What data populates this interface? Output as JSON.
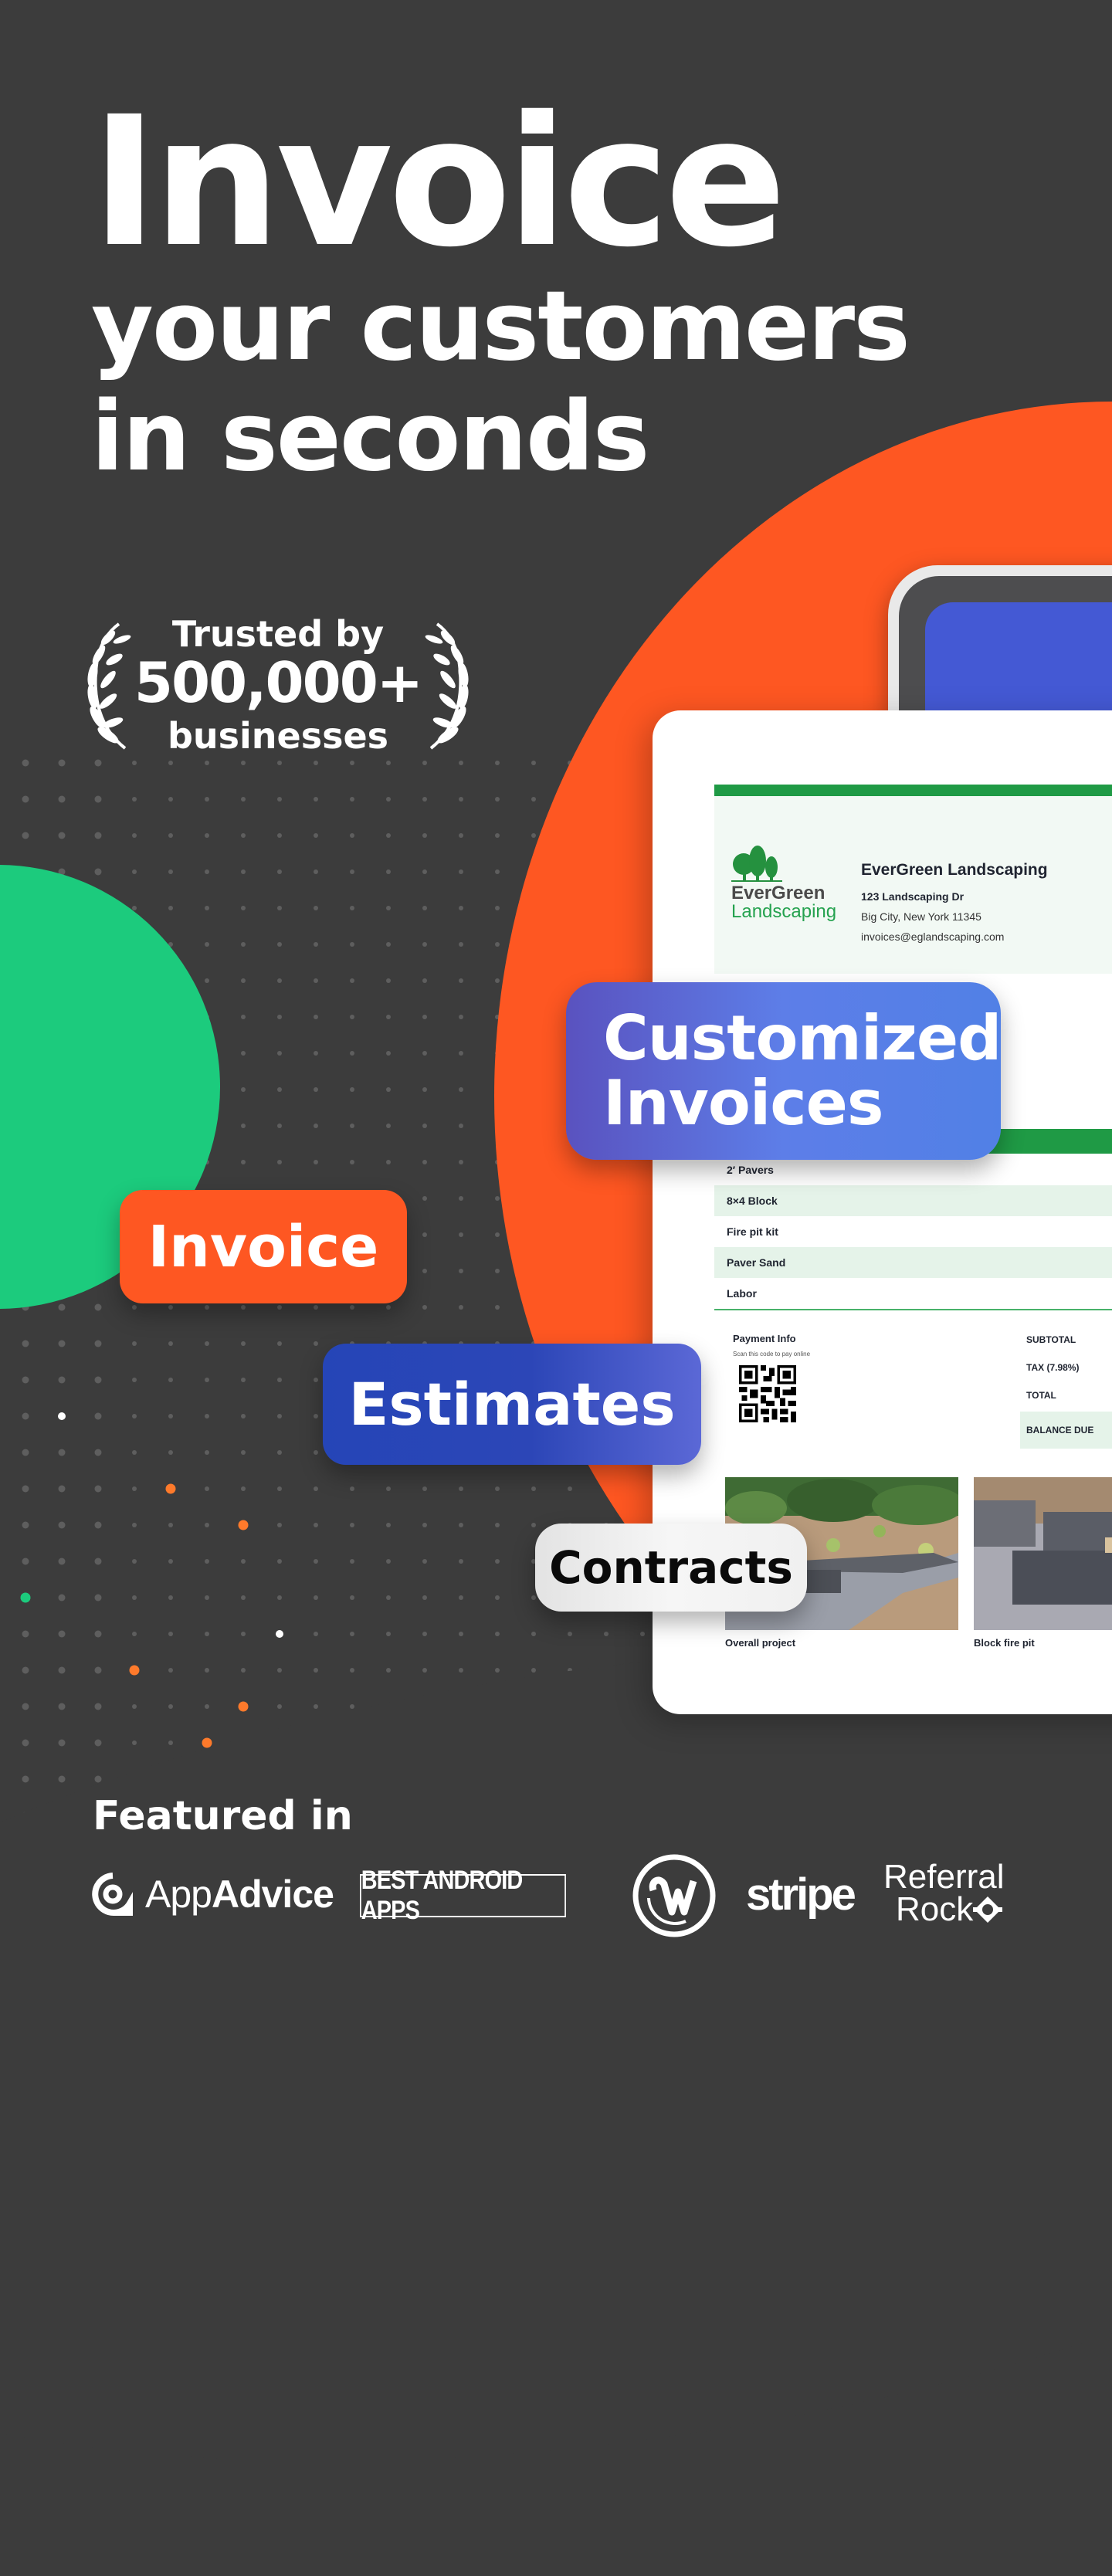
{
  "headline": {
    "line1": "Invoice",
    "line2": "your customers",
    "line3": "in seconds"
  },
  "trust_badge": {
    "line1": "Trusted by",
    "count": "500,000+",
    "line3": "businesses"
  },
  "feature_pills": {
    "customized_line1": "Customized",
    "customized_line2": "Invoices",
    "invoice": "Invoice",
    "estimates": "Estimates",
    "contracts": "Contracts"
  },
  "invoice_preview": {
    "logo_word1": "EverGreen",
    "logo_word2": "Landscaping",
    "company_name": "EverGreen Landscaping",
    "address_line1": "123 Landscaping Dr",
    "address_line2": "Big City, New York 11345",
    "email": "invoices@eglandscaping.com",
    "line_items": [
      "2′ Pavers",
      "8×4 Block",
      "Fire pit kit",
      "Paver Sand",
      "Labor"
    ],
    "payment_title": "Payment Info",
    "payment_subtitle": "Scan this code to pay online",
    "totals": {
      "subtotal": "SUBTOTAL",
      "tax": "TAX (7.98%)",
      "total": "TOTAL",
      "balance_due": "BALANCE DUE"
    },
    "photos": [
      {
        "caption": "Overall project"
      },
      {
        "caption": "Block fire pit"
      }
    ]
  },
  "featured": {
    "label": "Featured in",
    "logos": {
      "appadvice_light": "App",
      "appadvice_bold": "Advice",
      "best_android": "BEST ANDROID APPS",
      "stripe": "stripe",
      "referral_line1": "Referral",
      "referral_line2": "Rock"
    }
  },
  "colors": {
    "background": "#3c3c3c",
    "orange": "#fe5722",
    "green": "#1ccb7d",
    "blue": "#2545b7",
    "invoice_green": "#1f9a45"
  }
}
